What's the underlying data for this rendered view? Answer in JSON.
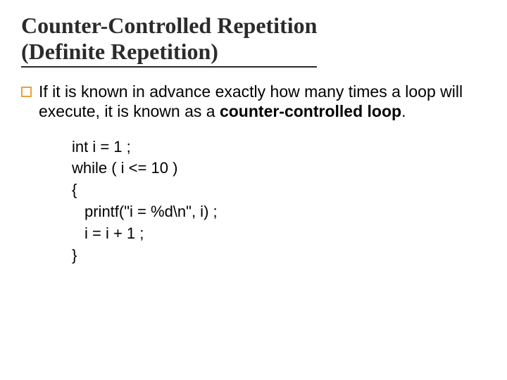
{
  "title": {
    "line1": "Counter-Controlled Repetition",
    "line2": " (Definite Repetition)"
  },
  "body": {
    "pre": "If it is known in advance exactly how many times a loop will execute, it is known as a ",
    "bold": "counter-controlled loop",
    "post": "."
  },
  "code": {
    "l1": "int i = 1 ;",
    "l2": "while ( i <= 10 )",
    "l3": "{",
    "l4": "printf(\"i = %d\\n\", i) ;",
    "l5": "i = i + 1 ;",
    "l6": "}"
  }
}
